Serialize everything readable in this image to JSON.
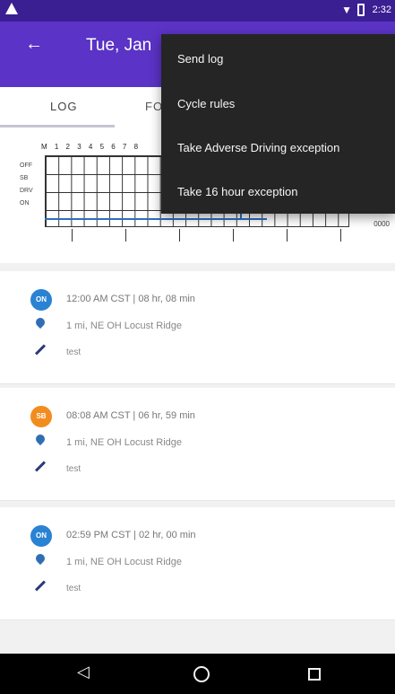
{
  "status_bar": {
    "time": "2:32",
    "warning_icon": "warning-icon",
    "signal_icon": "signal-icon",
    "battery_icon": "battery-icon"
  },
  "app_bar": {
    "back_icon": "back-arrow-icon",
    "title": "Tue, Jan"
  },
  "tabs": [
    {
      "label": "LOG"
    },
    {
      "label": "FO"
    }
  ],
  "graph": {
    "hours_label": "M 1 2 3 4 5 6 7 8",
    "rows": [
      "OFF",
      "SB",
      "DRV",
      "ON"
    ],
    "total": "0000"
  },
  "log_entries": [
    {
      "status": "ON",
      "time": "12:00 AM CST",
      "duration": "08 hr, 08 min",
      "location": "1 mi, NE OH Locust Ridge",
      "note": "test",
      "color": "#2a82d3"
    },
    {
      "status": "SB",
      "time": "08:08 AM CST",
      "duration": "06 hr, 59 min",
      "location": "1 mi, NE OH Locust Ridge",
      "note": "test",
      "color": "#f28c1e"
    },
    {
      "status": "ON",
      "time": "02:59 PM CST",
      "duration": "02 hr, 00 min",
      "location": "1 mi, NE OH Locust Ridge",
      "note": "test",
      "color": "#2a82d3"
    }
  ],
  "overflow_menu": {
    "items": [
      {
        "label": "Send log"
      },
      {
        "label": "Cycle rules"
      },
      {
        "label": "Take Adverse Driving exception"
      },
      {
        "label": "Take 16 hour exception"
      }
    ]
  },
  "nav_bar": {
    "back_icon": "nav-back-icon",
    "home_icon": "nav-home-icon",
    "recent_icon": "nav-recent-icon"
  },
  "colors": {
    "status_bar": "#3a1f93",
    "app_bar": "#5b33c6",
    "on_duty": "#2a82d3",
    "sleeper": "#f28c1e",
    "menu_bg": "#252525"
  }
}
